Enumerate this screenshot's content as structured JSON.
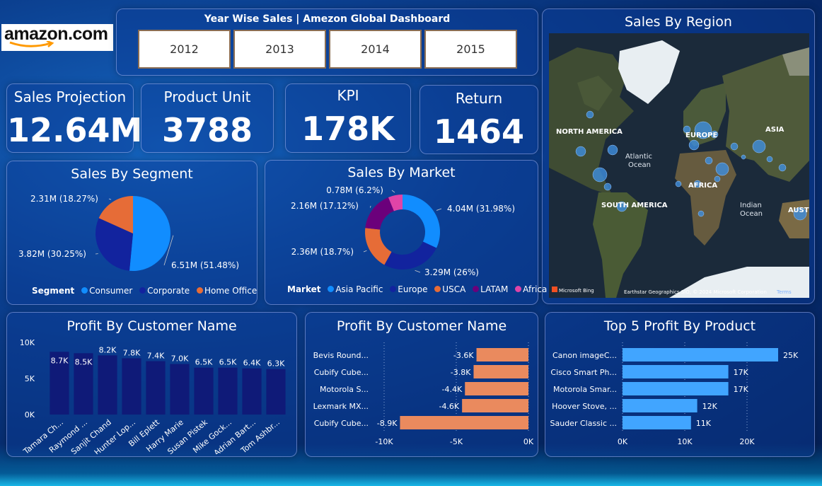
{
  "brand": {
    "logo_text": "amazon.com"
  },
  "header": {
    "title": "Year Wise Sales | Amezon Global Dashboard",
    "years": [
      "2012",
      "2013",
      "2014",
      "2015"
    ]
  },
  "kpis": [
    {
      "label": "Sales Projection",
      "value": "12.64M"
    },
    {
      "label": "Product Unit",
      "value": "3788"
    },
    {
      "label": "KPI",
      "value": "178K"
    },
    {
      "label": "Return",
      "value": "1464"
    }
  ],
  "map": {
    "title": "Sales By Region",
    "labels": {
      "na": "NORTH AMERICA",
      "europe": "EUROPE",
      "asia": "ASIA",
      "africa": "AFRICA",
      "sa": "SOUTH AMERICA",
      "atlantic": "Atlantic Ocean",
      "indian": "Indian Ocean",
      "aus": "AUSTR"
    },
    "attribution": "Earthstar Geographics SIO, © 2024 Microsoft Corporation",
    "terms": "Terms",
    "bing": "Microsoft Bing"
  },
  "colors": {
    "blue": "#118dff",
    "navy": "#12239e",
    "orange": "#e66c37",
    "purple": "#6b007b",
    "pink": "#e044a7",
    "barNavy": "#0f1a78",
    "barOrange": "#ea8a5e",
    "barBlue": "#41a5ff"
  },
  "chart_data": [
    {
      "type": "pie",
      "title": "Sales By Segment",
      "legend_title": "Segment",
      "categories": [
        "Consumer",
        "Corporate",
        "Home Office"
      ],
      "values": [
        6.51,
        3.82,
        2.31
      ],
      "labels": [
        "6.51M (51.48%)",
        "3.82M (30.25%)",
        "2.31M (18.27%)"
      ],
      "legend_position": "bottom"
    },
    {
      "type": "pie",
      "title": "Sales By Market",
      "legend_title": "Market",
      "categories": [
        "Asia Pacific",
        "Europe",
        "USCA",
        "LATAM",
        "Africa"
      ],
      "values": [
        4.04,
        3.29,
        2.36,
        2.16,
        0.78
      ],
      "labels": [
        "4.04M (31.98%)",
        "3.29M (26%)",
        "2.36M (18.7%)",
        "2.16M (17.12%)",
        "0.78M (6.2%)"
      ],
      "legend_position": "bottom"
    },
    {
      "type": "bar",
      "title": "Profit By Customer Name",
      "categories": [
        "Tamara Ch...",
        "Raymond ...",
        "Sanjit Chand",
        "Hunter Lop...",
        "Bill Eplett",
        "Harry Marie",
        "Susan Pistek",
        "Mike Gock...",
        "Adrian Bart...",
        "Tom Ashbr..."
      ],
      "values": [
        8.7,
        8.5,
        8.2,
        7.8,
        7.4,
        7.0,
        6.5,
        6.5,
        6.4,
        6.3
      ],
      "value_labels": [
        "8.7K",
        "8.5K",
        "8.2K",
        "7.8K",
        "7.4K",
        "7.0K",
        "6.5K",
        "6.5K",
        "6.4K",
        "6.3K"
      ],
      "yticks": [
        "0K",
        "5K",
        "10K"
      ],
      "ylim": [
        0,
        10
      ]
    },
    {
      "type": "bar",
      "orientation": "horizontal",
      "title": "Profit By Customer Name",
      "categories": [
        "Bevis Round...",
        "Cubify Cube...",
        "Motorola S...",
        "Lexmark MX...",
        "Cubify Cube..."
      ],
      "values": [
        -3.6,
        -3.8,
        -4.4,
        -4.6,
        -8.9
      ],
      "value_labels": [
        "-3.6K",
        "-3.8K",
        "-4.4K",
        "-4.6K",
        "-8.9K"
      ],
      "xticks": [
        "-10K",
        "-5K",
        "0K"
      ],
      "xlim": [
        -10,
        0
      ]
    },
    {
      "type": "bar",
      "orientation": "horizontal",
      "title": "Top 5 Profit By Product",
      "categories": [
        "Canon imageC...",
        "Cisco Smart Ph...",
        "Motorola Smar...",
        "Hoover Stove, ...",
        "Sauder Classic ..."
      ],
      "values": [
        25,
        17,
        17,
        12,
        11
      ],
      "value_labels": [
        "25K",
        "17K",
        "17K",
        "12K",
        "11K"
      ],
      "xticks": [
        "0K",
        "10K",
        "20K"
      ],
      "xlim": [
        0,
        30
      ]
    }
  ]
}
